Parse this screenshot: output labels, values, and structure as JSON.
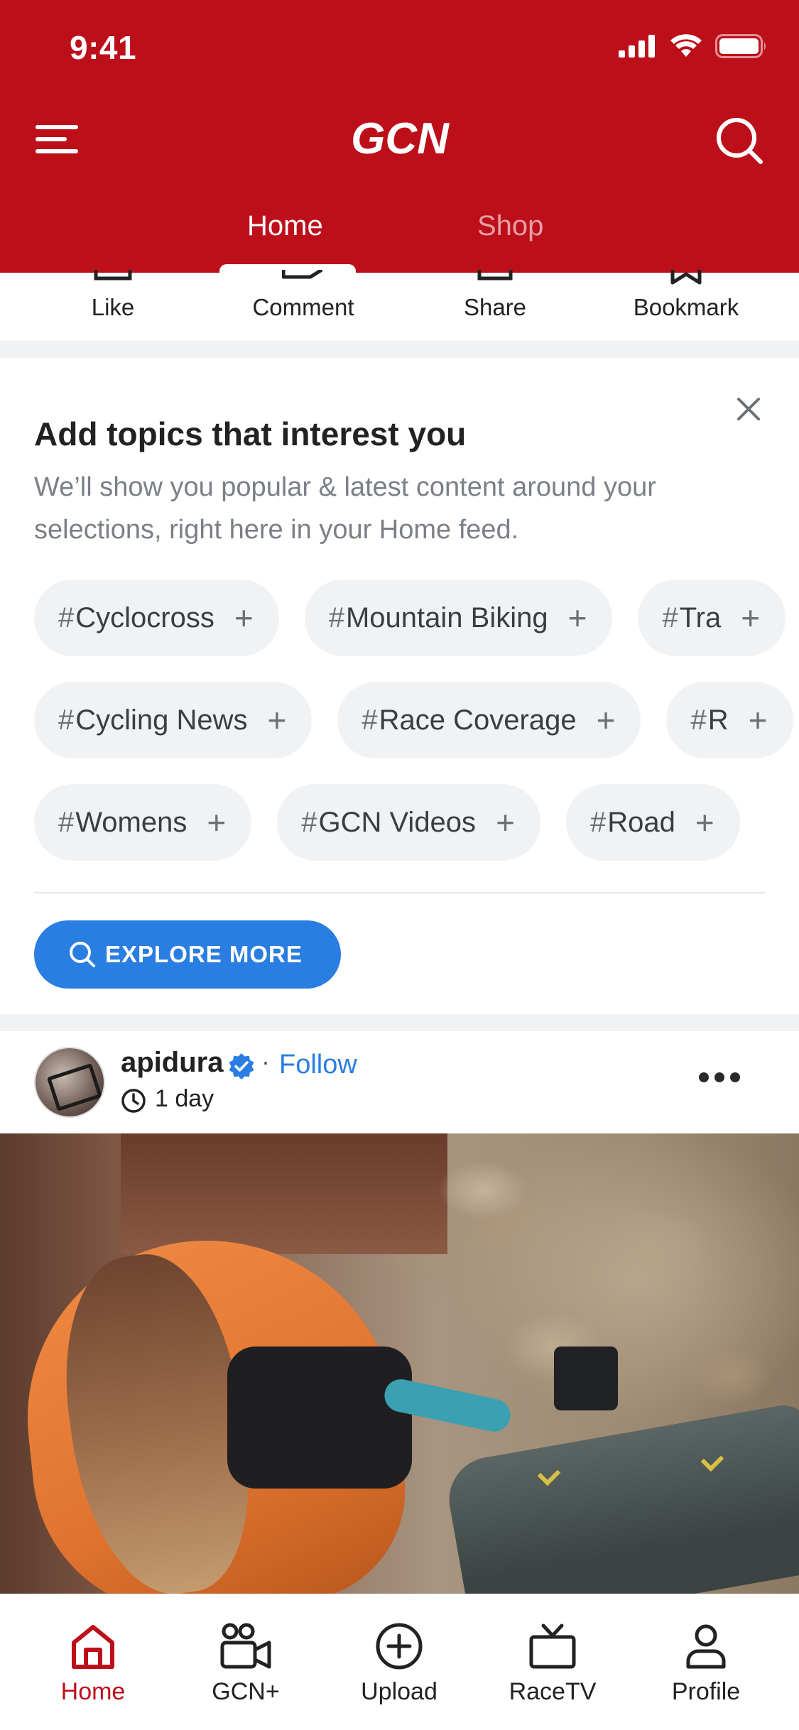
{
  "status_bar": {
    "time": "9:41"
  },
  "header": {
    "logo_text": "GCN",
    "tabs": [
      {
        "label": "Home",
        "active": true
      },
      {
        "label": "Shop",
        "active": false
      }
    ],
    "brand_color": "#bd0f1a"
  },
  "actions": [
    {
      "label": "Like",
      "icon": "like-icon"
    },
    {
      "label": "Comment",
      "icon": "comment-icon"
    },
    {
      "label": "Share",
      "icon": "share-icon"
    },
    {
      "label": "Bookmark",
      "icon": "bookmark-icon"
    }
  ],
  "topics": {
    "title": "Add topics that interest you",
    "subtitle": "We’ll show you popular & latest content around your selections, right here in your Home feed.",
    "rows": [
      [
        "Cyclocross",
        "Mountain Biking",
        "Tra"
      ],
      [
        "Cycling News",
        "Race Coverage",
        "R"
      ],
      [
        "Womens",
        "GCN Videos",
        "Road"
      ]
    ],
    "explore_label": "EXPLORE MORE",
    "explore_color": "#2a7de1"
  },
  "post": {
    "username": "apidura",
    "follow_label": "Follow",
    "separator": "·",
    "age": "1 day"
  },
  "bottom_nav": [
    {
      "label": "Home",
      "icon": "home-icon",
      "active": true
    },
    {
      "label": "GCN+",
      "icon": "gcn-plus-icon",
      "active": false
    },
    {
      "label": "Upload",
      "icon": "upload-icon",
      "active": false
    },
    {
      "label": "RaceTV",
      "icon": "tv-icon",
      "active": false
    },
    {
      "label": "Profile",
      "icon": "profile-icon",
      "active": false
    }
  ]
}
